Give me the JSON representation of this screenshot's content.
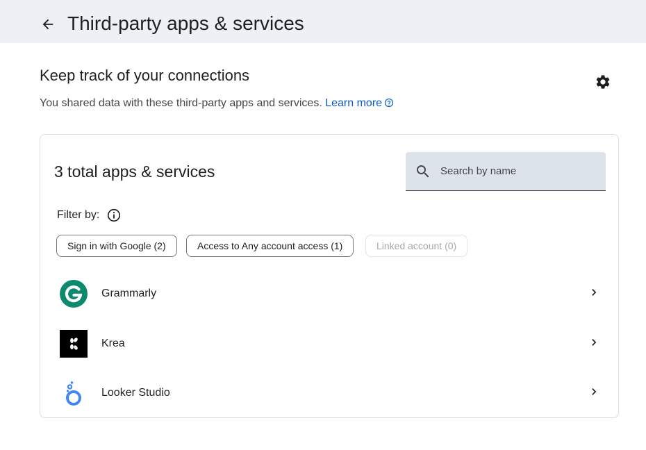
{
  "header": {
    "title": "Third-party apps & services",
    "back_icon": "arrow-back-icon"
  },
  "intro": {
    "heading": "Keep track of your connections",
    "description": "You shared data with these third-party apps and services.",
    "learn_more": "Learn more",
    "settings_icon": "gear-icon"
  },
  "card": {
    "count_title": "3 total apps & services",
    "search": {
      "placeholder": "Search by name",
      "value": ""
    },
    "filter": {
      "label": "Filter by:",
      "chips": [
        {
          "label": "Sign in with Google (2)",
          "enabled": true
        },
        {
          "label": "Access to Any account access (1)",
          "enabled": true
        },
        {
          "label": "Linked account (0)",
          "enabled": false
        }
      ]
    },
    "apps": [
      {
        "name": "Grammarly",
        "logo": "grammarly-logo"
      },
      {
        "name": "Krea",
        "logo": "krea-logo"
      },
      {
        "name": "Looker Studio",
        "logo": "looker-studio-logo"
      }
    ]
  },
  "colors": {
    "header_bg": "#edf0f5",
    "link": "#0b57d0",
    "search_bg": "#dde3ea",
    "grammarly_green": "#0d8a6e",
    "looker_blue": "#4285f4"
  }
}
